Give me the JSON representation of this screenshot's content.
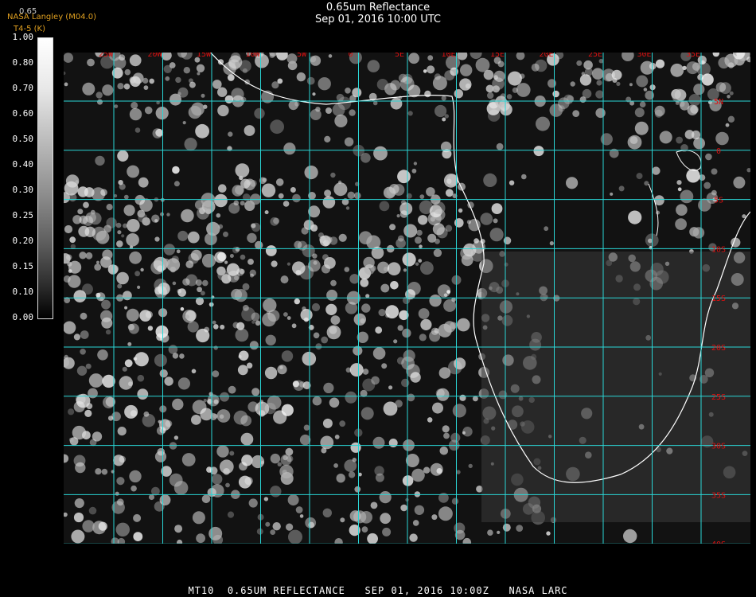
{
  "header": {
    "title": "0.65um Reflectance",
    "subtitle": "Sep 01, 2016 10:00 UTC",
    "credit": "NASA Langley (M04.0)",
    "credit2": "T4-5 (K)",
    "top_small": "0.65"
  },
  "colorbar": {
    "ticks": [
      "1.00",
      "0.80",
      "0.70",
      "0.60",
      "0.50",
      "0.40",
      "0.30",
      "0.25",
      "0.20",
      "0.15",
      "0.10",
      "0.00"
    ]
  },
  "map": {
    "lon_labels": [
      "25W",
      "20W",
      "15W",
      "10W",
      "5W",
      "0",
      "5E",
      "10E",
      "15E",
      "20E",
      "25E",
      "30E",
      "35E"
    ],
    "lat_labels": [
      "5N",
      "0",
      "5S",
      "10S",
      "15S",
      "20S",
      "25S",
      "30S",
      "35S",
      "40S"
    ],
    "grid_color": "#2ad6d6",
    "coast_color": "#ffffff",
    "label_color": "#e01010"
  },
  "footer": {
    "text": "MT10  0.65UM REFLECTANCE   SEP 01, 2016 10:00Z   NASA LARC"
  }
}
